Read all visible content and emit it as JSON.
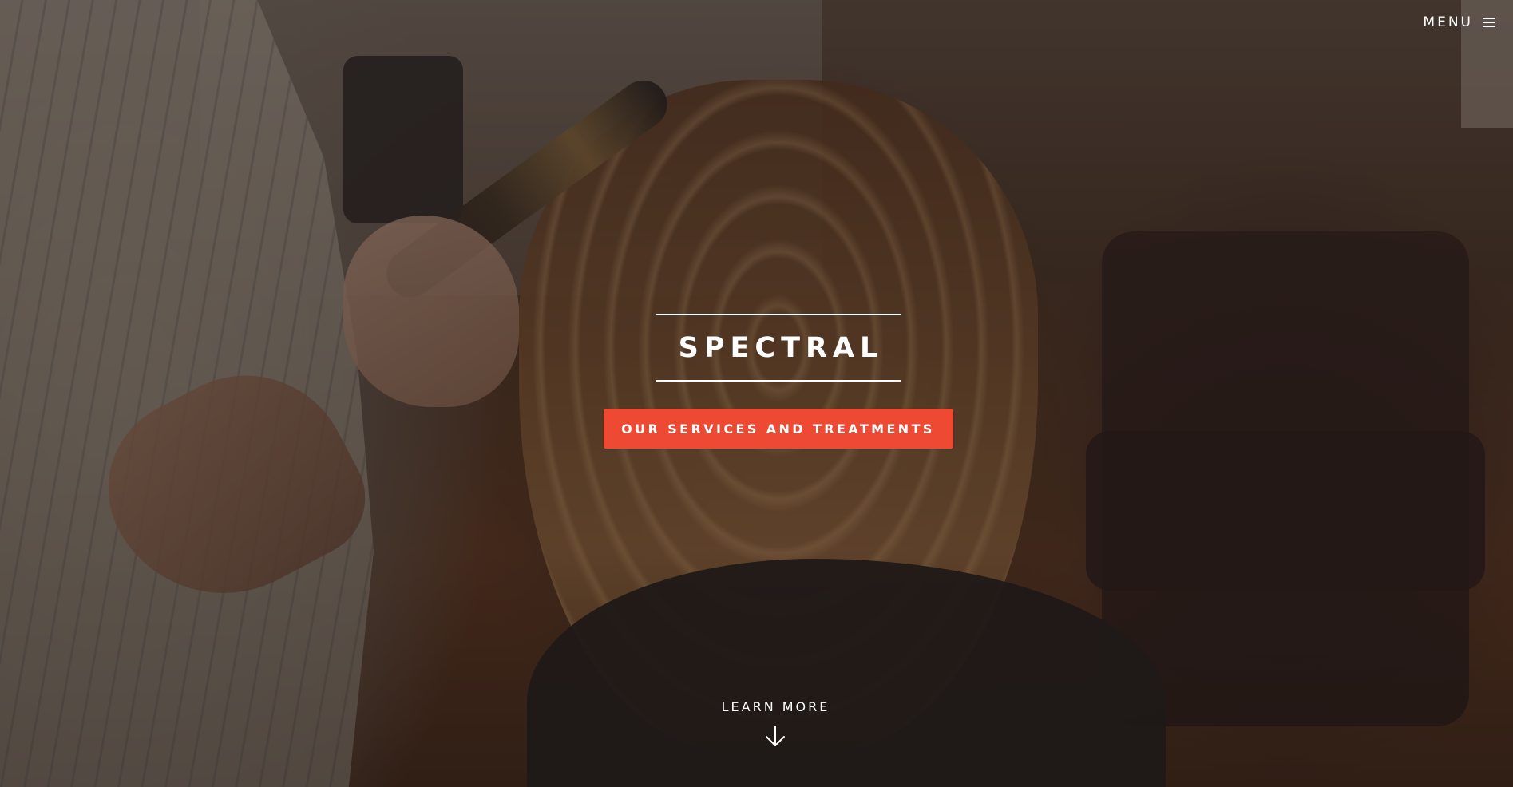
{
  "header": {
    "menu_label": "MENU",
    "menu_icon": "hamburger-icon"
  },
  "banner": {
    "title": "SPECTRAL",
    "cta_label": "OUR SERVICES AND TREATMENTS"
  },
  "learn_more": {
    "label": "LEARN MORE",
    "icon": "arrow-down-icon"
  },
  "colors": {
    "accent": "#ed4933",
    "text": "#ffffff"
  }
}
